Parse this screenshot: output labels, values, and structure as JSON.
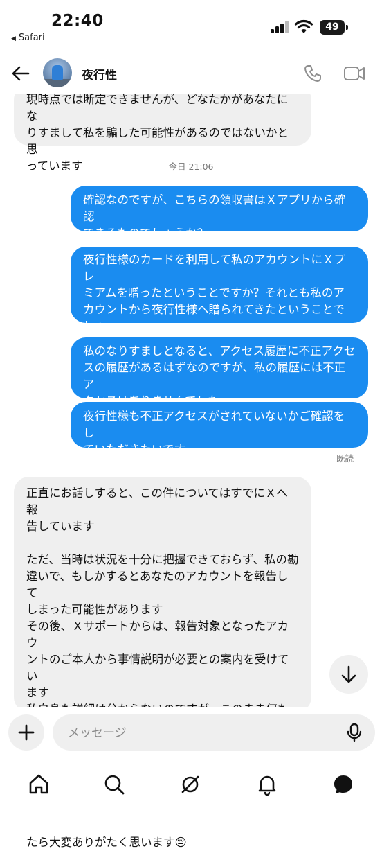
{
  "status_bar": {
    "time": "22:40",
    "back_app": "Safari",
    "battery": "49"
  },
  "header": {
    "contact_name": "夜行性"
  },
  "messages": {
    "m0": "現時点では断定できませんが、どなたかがあなたにな\nりすまして私を騙した可能性があるのではないかと思\nっています",
    "timestamp": "今日 21:06",
    "m1": "確認なのですが、こちらの領収書はＸアプリから確認\nできるものでしょうか？",
    "m2": "夜行性様のカードを利用して私のアカウントにＸプレ\nミアムを贈ったということですか？それとも私のア\nカウントから夜行性様へ贈られてきたということでしょ\nうか？",
    "m3": "私のなりすましとなると、アクセス履歴に不正アクセ\nスの履歴があるはずなのですが、私の履歴には不正ア\nクセスはありませんでした。",
    "m4": "夜行性様も不正アクセスがされていないかご確認をし\nていただきたいです。",
    "read_receipt": "既読",
    "m5": "正直にお話しすると、この件についてはすでにＸへ報\n告しています\n\nただ、当時は状況を十分に把握できておらず、私の勘\n違いで、もしかするとあなたのアカウントを報告して\nしまった可能性があります\nその後、Ｘサポートからは、報告対象となったアカウ\nントのご本人から事情説明が必要との案内を受けてい\nます\n私自身も詳細は分からないのですが、このまま何も対\n応がない場合、アカウントに何らかの制限や問題が生\nじる可能性があるとも聞いています\nご迷惑をおかけしてしまい、本当に申し訳ありませ\nん。もし状況をご理解いただき、ご協力いただけまし\nたら大変ありがたく思います😔"
  },
  "composer": {
    "placeholder": "メッセージ"
  },
  "icons": {
    "tabs": [
      "home-icon",
      "search-icon",
      "explore-icon",
      "notifications-icon",
      "messages-icon"
    ]
  },
  "colors": {
    "outgoing_bubble": "#1a8cf0",
    "incoming_bubble": "#efefef"
  }
}
